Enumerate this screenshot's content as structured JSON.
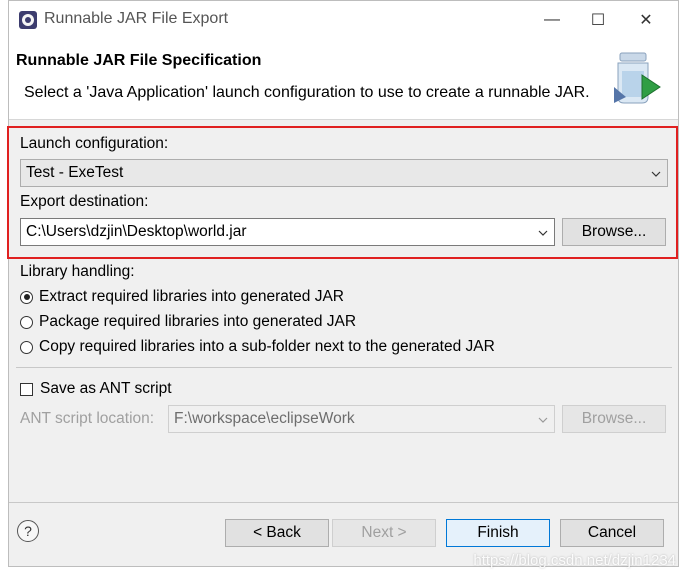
{
  "window": {
    "title": "Runnable JAR File Export",
    "minimize_glyph": "—",
    "maximize_glyph": "☐",
    "close_glyph": "✕"
  },
  "header": {
    "title": "Runnable JAR File Specification",
    "description": "Select a 'Java Application' launch configuration to use to create a runnable JAR."
  },
  "launch": {
    "label": "Launch configuration:",
    "value": "Test - ExeTest"
  },
  "export": {
    "label": "Export destination:",
    "value": "C:\\Users\\dzjin\\Desktop\\world.jar",
    "browse_label": "Browse..."
  },
  "library": {
    "label": "Library handling:",
    "options": [
      {
        "label": "Extract required libraries into generated JAR",
        "checked": true
      },
      {
        "label": "Package required libraries into generated JAR",
        "checked": false
      },
      {
        "label": "Copy required libraries into a sub-folder next to the generated JAR",
        "checked": false
      }
    ]
  },
  "ant": {
    "save_label": "Save as ANT script",
    "location_label": "ANT script location:",
    "location_value": "F:\\workspace\\eclipseWork",
    "browse_label": "Browse..."
  },
  "footer": {
    "help_glyph": "?",
    "back_label": "< Back",
    "next_label": "Next >",
    "finish_label": "Finish",
    "cancel_label": "Cancel"
  },
  "watermark": "https://blog.csdn.net/dzjin1234",
  "colors": {
    "highlight": "#e02020",
    "accent": "#0078d7"
  },
  "icons": [
    "eclipse-app-icon",
    "jar-wizard-icon",
    "chevron-down-icon",
    "help-icon"
  ]
}
